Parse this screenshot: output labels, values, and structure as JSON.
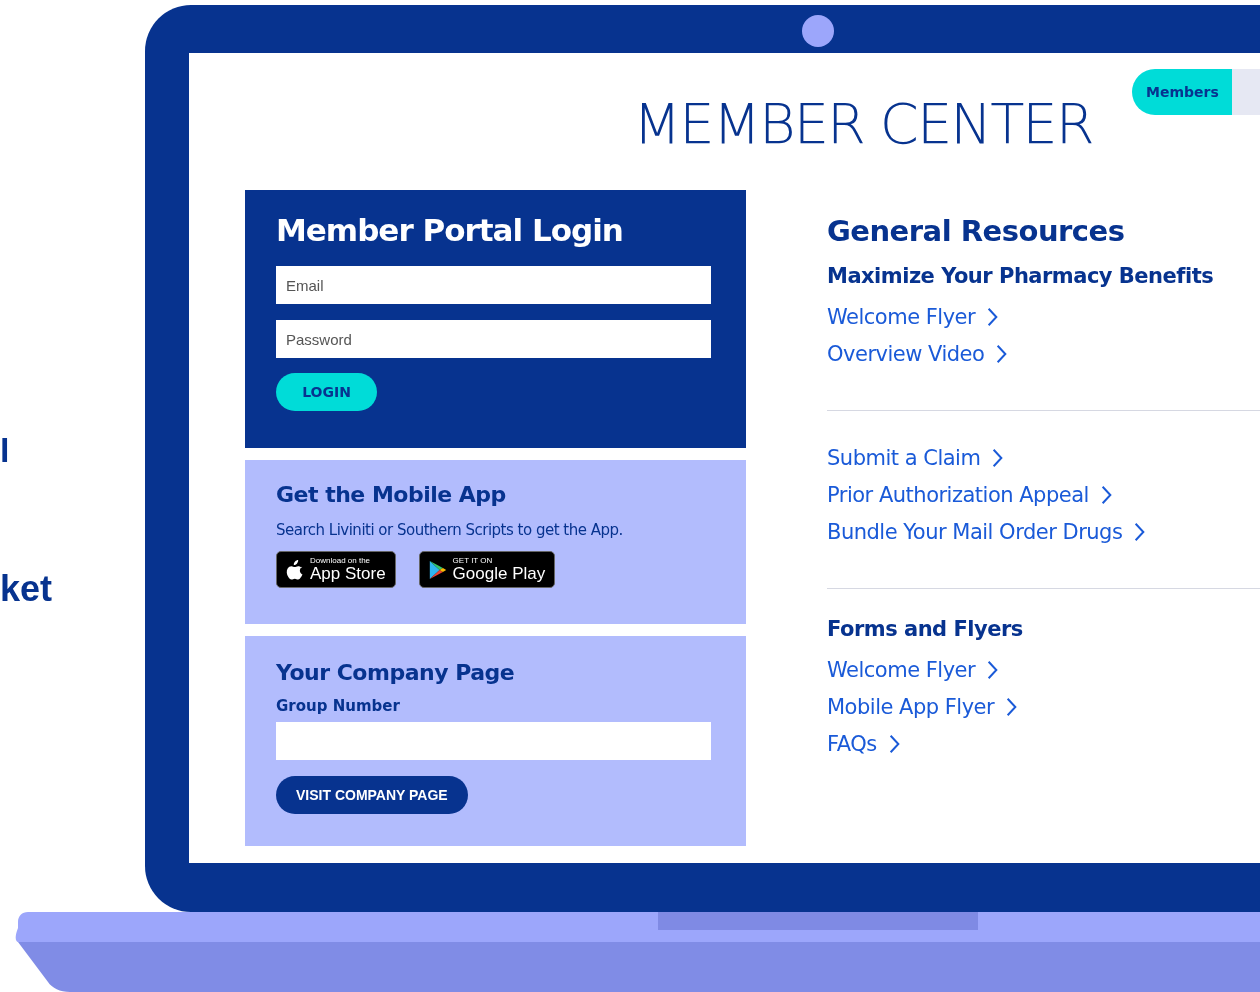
{
  "side_text": [
    "l",
    "ket"
  ],
  "header": {
    "title": "MEMBER CENTER",
    "tabs": [
      {
        "label": "Members",
        "selected": true
      }
    ]
  },
  "login": {
    "title": "Member Portal Login",
    "fields": [
      {
        "placeholder": "Email"
      },
      {
        "placeholder": "Password"
      }
    ],
    "button": "LOGIN"
  },
  "mobile_app": {
    "title": "Get the Mobile App",
    "text": "Search Liviniti or Southern Scripts to get the App.",
    "badges": [
      {
        "kind": "apple",
        "small": "Download on the",
        "big": "App Store"
      },
      {
        "kind": "google",
        "small": "GET IT ON",
        "big": "Google Play"
      }
    ]
  },
  "company": {
    "title": "Your Company Page",
    "label": "Group Number",
    "button": "VISIT COMPANY PAGE"
  },
  "resources": {
    "title": "General Resources",
    "sections": [
      {
        "heading": "Maximize Your Pharmacy Benefits",
        "links": [
          "Welcome Flyer",
          "Overview Video"
        ]
      },
      {
        "links": [
          "Submit a Claim",
          "Prior Authorization Appeal",
          "Bundle Your Mail Order Drugs"
        ]
      },
      {
        "heading": "Forms and Flyers",
        "links": [
          "Welcome Flyer",
          "Mobile App Flyer",
          "FAQs"
        ]
      }
    ]
  }
}
